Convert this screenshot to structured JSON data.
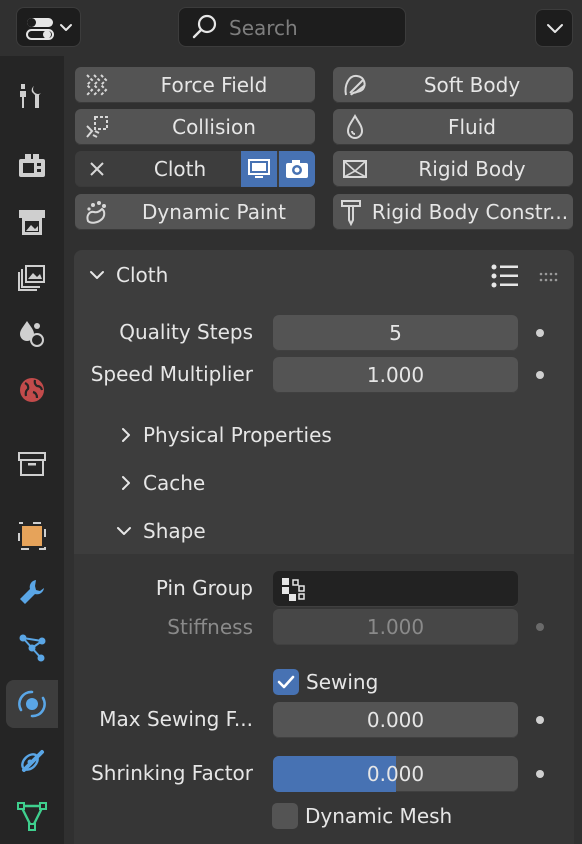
{
  "header": {
    "search_placeholder": "Search"
  },
  "sidebar": {
    "tabs": [
      {
        "name": "tool-tab-icon",
        "active": false
      },
      {
        "name": "render-tab-icon",
        "active": false
      },
      {
        "name": "output-tab-icon",
        "active": false
      },
      {
        "name": "view-layer-tab-icon",
        "active": false
      },
      {
        "name": "scene-tab-icon",
        "active": false
      },
      {
        "name": "world-tab-icon",
        "active": false
      },
      {
        "name": "collection-tab-icon",
        "active": false
      },
      {
        "name": "object-tab-icon",
        "active": false
      },
      {
        "name": "modifier-tab-icon",
        "active": false
      },
      {
        "name": "particles-tab-icon",
        "active": false
      },
      {
        "name": "physics-tab-icon",
        "active": true
      },
      {
        "name": "constraints-tab-icon",
        "active": false
      },
      {
        "name": "data-tab-icon",
        "active": false
      }
    ]
  },
  "physics_buttons": {
    "force_field": "Force Field",
    "soft_body": "Soft Body",
    "collision": "Collision",
    "fluid": "Fluid",
    "cloth": "Cloth",
    "rigid_body": "Rigid Body",
    "dynamic_paint": "Dynamic Paint",
    "rigid_body_constraint": "Rigid Body Constr..."
  },
  "cloth_panel": {
    "title": "Cloth",
    "quality_steps_label": "Quality Steps",
    "quality_steps_value": "5",
    "speed_multiplier_label": "Speed Multiplier",
    "speed_multiplier_value": "1.000",
    "physical_properties": "Physical Properties",
    "cache": "Cache",
    "shape": "Shape"
  },
  "shape": {
    "pin_group_label": "Pin Group",
    "stiffness_label": "Stiffness",
    "stiffness_value": "1.000",
    "sewing_label": "Sewing",
    "sewing_checked": true,
    "max_sewing_label": "Max Sewing F...",
    "max_sewing_value": "0.000",
    "shrinking_label": "Shrinking Factor",
    "shrinking_value": "0.000",
    "shrinking_fill": 0.5,
    "dynamic_mesh_label": "Dynamic Mesh",
    "dynamic_mesh_checked": false
  },
  "colors": {
    "accent": "#4772b3",
    "panel": "#3d3d3d",
    "field": "#545454"
  }
}
